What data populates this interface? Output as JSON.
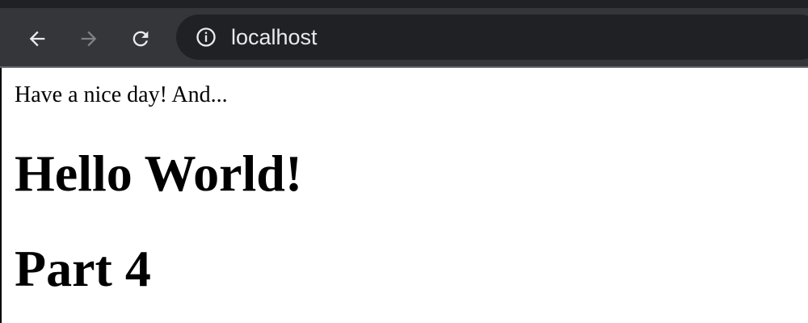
{
  "browser": {
    "url": "localhost",
    "back_icon": "arrow-left-icon",
    "forward_icon": "arrow-right-icon",
    "reload_icon": "reload-icon",
    "info_icon": "info-icon",
    "forward_enabled": false,
    "colors": {
      "chrome_bg": "#35363a",
      "omnibox_bg": "#202124",
      "url_text": "#e8eaed",
      "icon_active": "#e8eaed",
      "icon_disabled": "#7f8185"
    }
  },
  "page": {
    "intro": "Have a nice day! And...",
    "headings": [
      "Hello World!",
      "Part 4"
    ]
  }
}
